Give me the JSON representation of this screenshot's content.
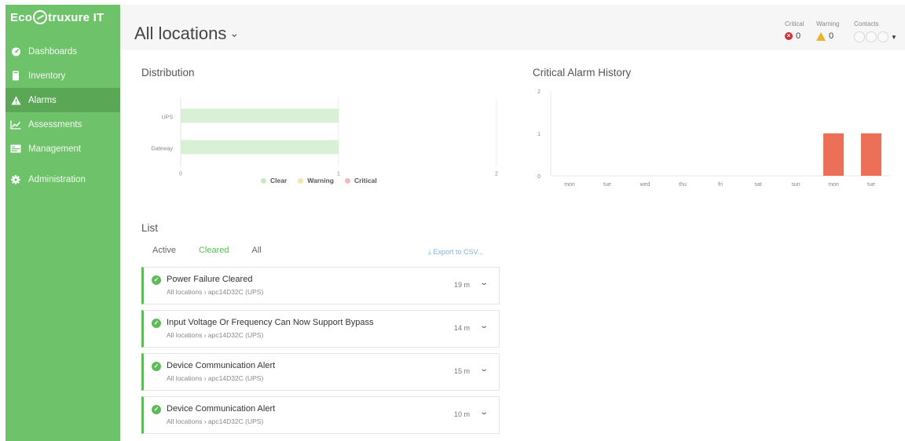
{
  "app": {
    "logo_left": "Eco",
    "logo_right": "truxure IT"
  },
  "sidebar": {
    "items": [
      {
        "label": "Dashboards",
        "icon": "dashboard-icon",
        "active": false
      },
      {
        "label": "Inventory",
        "icon": "inventory-icon",
        "active": false
      },
      {
        "label": "Alarms",
        "icon": "alarm-icon",
        "active": true
      },
      {
        "label": "Assessments",
        "icon": "chart-icon",
        "active": false
      },
      {
        "label": "Management",
        "icon": "management-icon",
        "active": false
      },
      {
        "label": "Administration",
        "icon": "gear-icon",
        "active": false
      }
    ]
  },
  "header": {
    "title": "All locations",
    "critical_label": "Critical",
    "critical_count": "0",
    "warning_label": "Warning",
    "warning_count": "0",
    "contacts_label": "Contacts"
  },
  "distribution": {
    "title": "Distribution",
    "legend": [
      {
        "label": "Clear",
        "color": "#c9e9c6"
      },
      {
        "label": "Warning",
        "color": "#f5e2b0"
      },
      {
        "label": "Critical",
        "color": "#f3b9c0"
      }
    ]
  },
  "history": {
    "title": "Critical Alarm History"
  },
  "chart_data": [
    {
      "type": "bar",
      "orientation": "horizontal",
      "categories": [
        "UPS",
        "Gateway"
      ],
      "series": [
        {
          "name": "Clear",
          "values": [
            1,
            1
          ],
          "color": "#d9f0d6"
        },
        {
          "name": "Warning",
          "values": [
            0,
            0
          ],
          "color": "#f5e2b0"
        },
        {
          "name": "Critical",
          "values": [
            0,
            0
          ],
          "color": "#f3b9c0"
        }
      ],
      "xlim": [
        0,
        2
      ],
      "xticks": [
        "0",
        "1",
        "2"
      ],
      "title": "Distribution",
      "legend_position": "bottom"
    },
    {
      "type": "bar",
      "categories": [
        "mon",
        "tue",
        "wed",
        "thu",
        "fri",
        "sat",
        "sun",
        "mon",
        "tue"
      ],
      "values": [
        0,
        0,
        0,
        0,
        0,
        0,
        0,
        1,
        1
      ],
      "color": "#ec6f58",
      "ylim": [
        0,
        2
      ],
      "yticks": [
        "0",
        "1",
        "2"
      ],
      "title": "Critical Alarm History"
    }
  ],
  "list": {
    "title": "List",
    "tabs": [
      "Active",
      "Cleared",
      "All"
    ],
    "active_tab": "Cleared",
    "export_label": "Export to CSV...",
    "alarms": [
      {
        "title": "Power Failure Cleared",
        "path": "All locations › apc14D32C (UPS)",
        "age": "19 m"
      },
      {
        "title": "Input Voltage Or Frequency Can Now Support Bypass",
        "path": "All locations › apc14D32C (UPS)",
        "age": "14 m"
      },
      {
        "title": "Device Communication Alert",
        "path": "All locations › apc14D32C (UPS)",
        "age": "15 m"
      },
      {
        "title": "Device Communication Alert",
        "path": "All locations › apc14D32C (UPS)",
        "age": "10 m"
      }
    ]
  }
}
